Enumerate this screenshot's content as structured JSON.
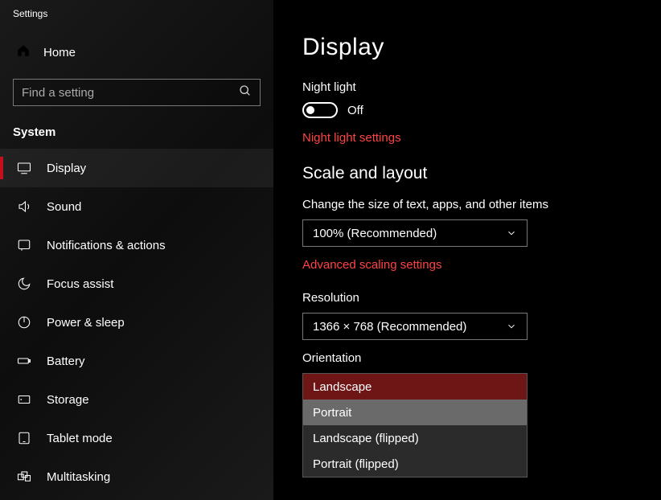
{
  "app": {
    "title": "Settings"
  },
  "sidebar": {
    "home": "Home",
    "search_placeholder": "Find a setting",
    "section": "System",
    "items": [
      {
        "label": "Display",
        "icon": "display-icon",
        "selected": true
      },
      {
        "label": "Sound",
        "icon": "sound-icon"
      },
      {
        "label": "Notifications & actions",
        "icon": "notifications-icon"
      },
      {
        "label": "Focus assist",
        "icon": "focus-assist-icon"
      },
      {
        "label": "Power & sleep",
        "icon": "power-icon"
      },
      {
        "label": "Battery",
        "icon": "battery-icon"
      },
      {
        "label": "Storage",
        "icon": "storage-icon"
      },
      {
        "label": "Tablet mode",
        "icon": "tablet-icon"
      },
      {
        "label": "Multitasking",
        "icon": "multitasking-icon"
      }
    ]
  },
  "page": {
    "title": "Display",
    "night_light": {
      "label": "Night light",
      "state": "Off",
      "link": "Night light settings"
    },
    "scale_section": "Scale and layout",
    "scale": {
      "label": "Change the size of text, apps, and other items",
      "value": "100% (Recommended)",
      "link": "Advanced scaling settings"
    },
    "resolution": {
      "label": "Resolution",
      "value": "1366 × 768 (Recommended)"
    },
    "orientation": {
      "label": "Orientation",
      "options": [
        "Landscape",
        "Portrait",
        "Landscape (flipped)",
        "Portrait (flipped)"
      ],
      "selected": "Landscape",
      "hover": "Portrait"
    }
  }
}
